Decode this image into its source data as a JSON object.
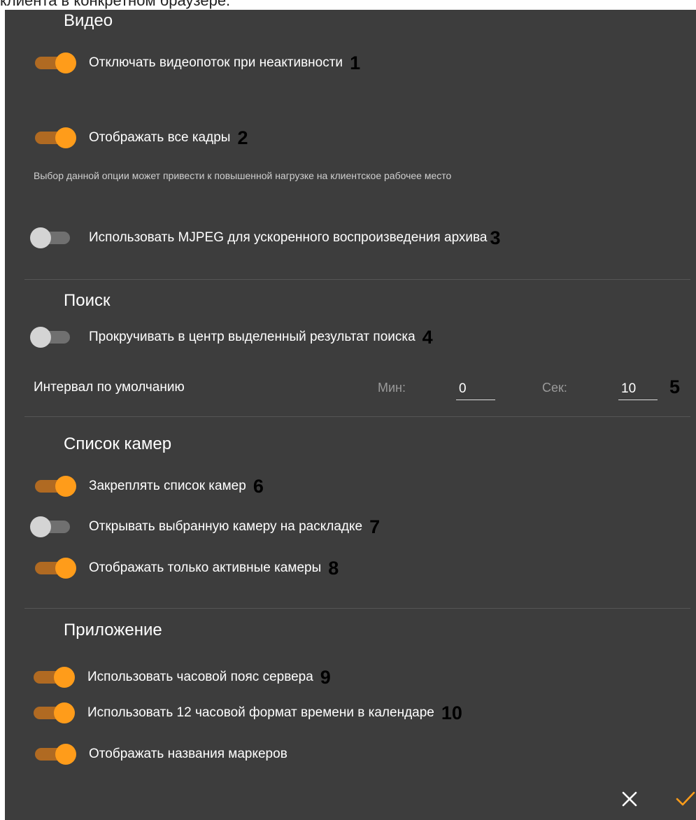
{
  "caption": "клиента в конкретном браузере.",
  "sections": {
    "video": {
      "title": "Видео",
      "items": [
        {
          "label": "Отключать видеопоток при неактивности",
          "on": true,
          "marker": "1"
        },
        {
          "label": "Отображать все кадры",
          "on": true,
          "marker": "2"
        },
        {
          "label": "Использовать MJPEG для ускоренного воспроизведения архива",
          "on": false,
          "marker": "3"
        }
      ],
      "hint": "Выбор данной опции может привести к повышенной нагрузке на клиентское рабочее место"
    },
    "search": {
      "title": "Поиск",
      "items": [
        {
          "label": "Прокручивать в центр выделенный результат поиска",
          "on": false,
          "marker": "4"
        }
      ],
      "interval": {
        "label": "Интервал по умолчанию",
        "min_label": "Мин:",
        "min_value": "0",
        "sec_label": "Сек:",
        "sec_value": "10",
        "marker": "5"
      }
    },
    "cameras": {
      "title": "Список камер",
      "items": [
        {
          "label": "Закреплять список камер",
          "on": true,
          "marker": "6"
        },
        {
          "label": "Открывать выбранную камеру на раскладке",
          "on": false,
          "marker": "7"
        },
        {
          "label": "Отображать только активные камеры",
          "on": true,
          "marker": "8"
        }
      ]
    },
    "app": {
      "title": "Приложение",
      "items": [
        {
          "label": "Использовать часовой пояс сервера",
          "on": true,
          "marker": "9"
        },
        {
          "label": "Использовать 12 часовой формат времени в календаре",
          "on": true,
          "marker": "10"
        },
        {
          "label": "Отображать названия маркеров",
          "on": true,
          "marker": ""
        }
      ]
    }
  },
  "footer": {
    "close_icon": "close-icon",
    "confirm_icon": "checkmark-icon"
  },
  "colors": {
    "panel_bg": "#3d3d3d",
    "accent": "#ff9c1a",
    "toggle_on_track": "#b06a22",
    "toggle_off_knob": "#d4d4d4",
    "toggle_off_track": "#707070"
  }
}
